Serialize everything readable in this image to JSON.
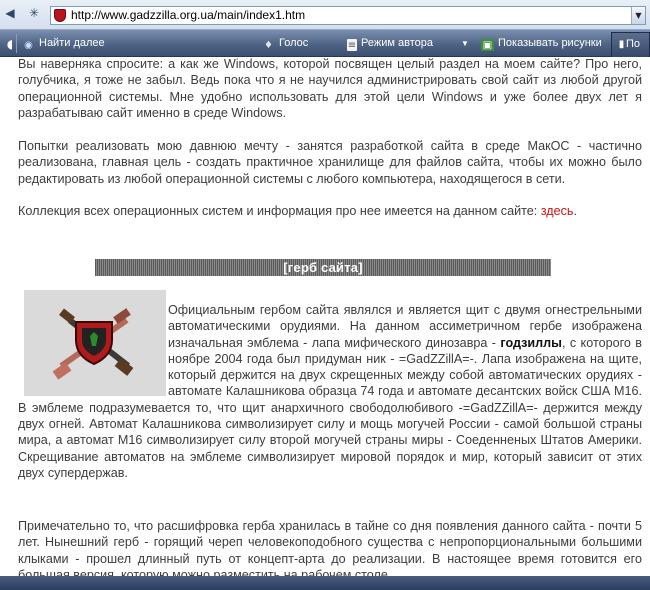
{
  "address_bar": {
    "url": "http://www.gadzzilla.org.ua/main/index1.htm"
  },
  "toolbar": {
    "find_next": "Найти далее",
    "voice": "Голос",
    "author_mode": "Режим автора",
    "show_images": "Показывать рисунки",
    "right_tab": "По"
  },
  "content": {
    "para1": "Вы наверняка спросите: а как же Windows, которой посвящен целый раздел на моем сайте? Про него, голубчика, я тоже не забыл. Ведь пока что я не научился администрировать свой сайт из любой другой операционной системы. Мне удобно использовать для этой цели Windows и уже более двух лет я разрабатываю сайт именно в среде Windows.",
    "para2": "Попытки реализовать мою давнюю мечту - занятся разработкой сайта в среде МакОС - частично реализована, главная цель - создать практичное хранилище для файлов сайта, чтобы их можно было редактировать из любой операционной системы с любого компьютера, находящегося в сети.",
    "para3_text": "Коллекция всех операционных систем и информация про нее имеется на данном сайте: ",
    "para3_link": "здесь",
    "para3_end": ".",
    "banner": "[герб сайта]",
    "emblem_p1": "Официальным гербом сайта являлся и является щит с двумя огнестрельными автоматическими орудиями. На данном ассиметричном гербе изображена изначальная эмблема - лапа мифического динозавра - ",
    "emblem_bold": "годзиллы",
    "emblem_p2": ", с которого в ноябре 2004 года был придуман ник - =GadZZillA=-. Лапа изображена на щите, который держится на двух скрещенных между собой автоматических орудиях - автомате Калашникова образца 74 года и автомате десантских войск США М16. В эмблеме подразумевается то, что щит анархичного свободолюбивого -=GadZZillA=- держится между двух огней. Автомат Калашникова символизирует силу и мощь могучей России - самой большой страны мира, а автомат М16 символизирует силу второй могучей страны миры - Соеденненых Штатов Америки. Скрещивание автоматов на эмблеме символизирует мировой порядок и мир, который зависит от этих двух супердержав.",
    "para5": "Примечательно то, что расшифровка герба хранилась в тайне со дня появления данного сайта - почти 5 лет. Нынешний герб - горящий череп человекоподобного существа с непропорциональными большими клыками - прошел длинный путь от концепт-арта до реализации. В настоящее время готовится его большая версия, которую можно разместить на рабочем столе."
  },
  "colors": {
    "link": "#d11010",
    "toolbar": "#4f6385",
    "text": "#3d3d3d"
  }
}
